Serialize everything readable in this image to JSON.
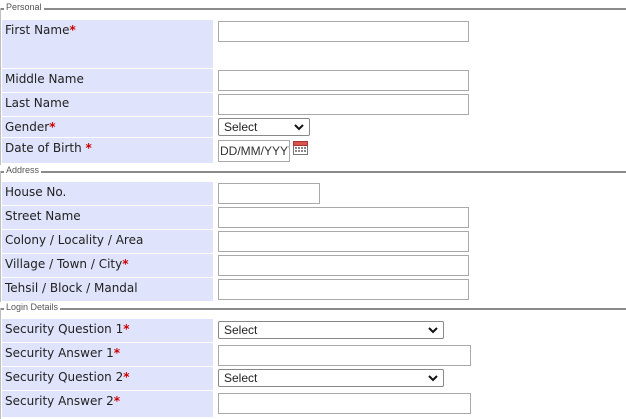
{
  "personal": {
    "legend": "Personal",
    "first_name": "First Name",
    "middle_name": "Middle Name",
    "last_name": "Last Name",
    "gender": "Gender",
    "gender_selected": "Select",
    "dob": "Date of Birth",
    "dob_placeholder": "DD/MM/YYYY"
  },
  "address": {
    "legend": "Address",
    "house_no": "House No.",
    "street_name": "Street Name",
    "colony": "Colony / Locality / Area",
    "village": "Village / Town / City",
    "tehsil": "Tehsil / Block / Mandal"
  },
  "login": {
    "legend": "Login Details",
    "q1": "Security Question 1",
    "q1_selected": "Select",
    "a1": "Security Answer 1",
    "q2": "Security Question 2",
    "q2_selected": "Select",
    "a2": "Security Answer 2"
  },
  "required_marker": "*",
  "icons": {
    "dropdown": "chevron-down-icon",
    "calendar": "calendar-icon"
  },
  "colors": {
    "label_bg": "#dfe3fb",
    "required": "#cc0000"
  }
}
